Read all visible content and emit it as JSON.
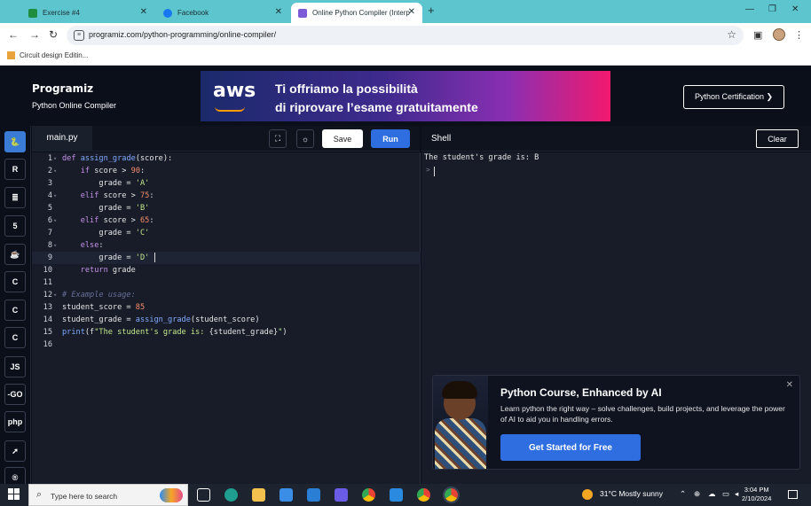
{
  "browser": {
    "tabs": [
      {
        "title": "Exercise #4",
        "color": "#1e8e3e"
      },
      {
        "title": "Facebook",
        "color": "#1877f2"
      },
      {
        "title": "Online Python Compiler (Interp",
        "color": "#7b5bd6"
      }
    ],
    "url": "programiz.com/python-programming/online-compiler/",
    "bookmark": "Circuit design Editin..."
  },
  "header": {
    "logo": "Programiz",
    "subtitle": "Python Online Compiler",
    "ad_brand": "aws",
    "ad_line1": "Ti offriamo la possibilità",
    "ad_line2": "di riprovare l’esame gratuitamente",
    "cert_button": "Python Certification ❯"
  },
  "sidebar": {
    "items": [
      {
        "name": "python",
        "label": "🐍"
      },
      {
        "name": "r",
        "label": "R"
      },
      {
        "name": "sql",
        "label": "≣"
      },
      {
        "name": "html",
        "label": "5"
      },
      {
        "name": "java",
        "label": "☕"
      },
      {
        "name": "c",
        "label": "C"
      },
      {
        "name": "cpp",
        "label": "C"
      },
      {
        "name": "csharp",
        "label": "C"
      },
      {
        "name": "js",
        "label": "JS"
      },
      {
        "name": "go",
        "label": "-GO"
      },
      {
        "name": "php",
        "label": "php"
      },
      {
        "name": "swift",
        "label": "➚"
      },
      {
        "name": "rust",
        "label": "®"
      }
    ]
  },
  "editor": {
    "filename": "main.py",
    "save_label": "Save",
    "run_label": "Run",
    "lines": [
      "def assign_grade(score):",
      "    if score > 90:",
      "        grade = 'A'",
      "    elif score > 75:",
      "        grade = 'B'",
      "    elif score > 65:",
      "        grade = 'C'",
      "    else:",
      "        grade = 'D'",
      "    return grade",
      "",
      "# Example usage:",
      "student_score = 85",
      "student_grade = assign_grade(student_score)",
      "print(f\"The student's grade is: {student_grade}\")",
      ""
    ]
  },
  "shell": {
    "title": "Shell",
    "clear_label": "Clear",
    "output": "The student's grade is: B",
    "prompt": ">"
  },
  "promo": {
    "title": "Python Course, Enhanced by AI",
    "description": "Learn python the right way – solve challenges, build projects, and leverage the power of AI to aid you in handling errors.",
    "cta": "Get Started for Free"
  },
  "taskbar": {
    "search_placeholder": "Type here to search",
    "weather": "31°C  Mostly sunny",
    "time": "3:04 PM",
    "date": "2/10/2024"
  }
}
